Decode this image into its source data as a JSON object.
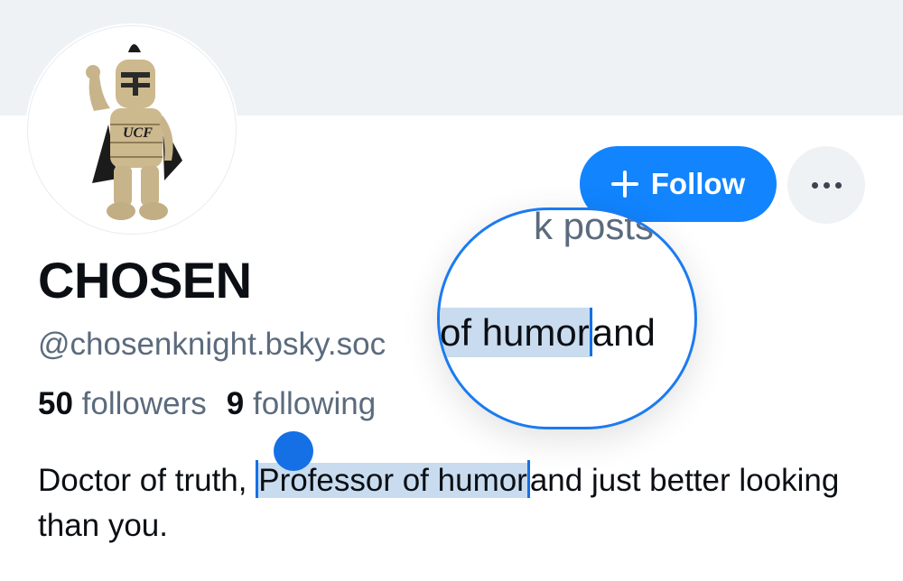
{
  "profile": {
    "display_name": "CHOSEN",
    "handle": "@chosenknight.bsky.soc",
    "followers_count": "50",
    "followers_label": "followers",
    "following_count": "9",
    "following_label": "following",
    "bio_pre": "Doctor of truth, ",
    "bio_selected": "Professor of humor",
    "bio_post": "and just better looking than you.",
    "avatar_text": "UCF"
  },
  "actions": {
    "follow_label": "Follow"
  },
  "magnifier": {
    "top_text": "k posts",
    "selected_text": "of humor",
    "after_text": "and"
  },
  "colors": {
    "accent": "#1184fe",
    "selection": "#c9dcef",
    "banner": "#eef2f5",
    "muted_text": "#5b6b7d"
  },
  "icons": [
    "plus-icon",
    "more-dots-icon",
    "selection-handle-icon"
  ]
}
